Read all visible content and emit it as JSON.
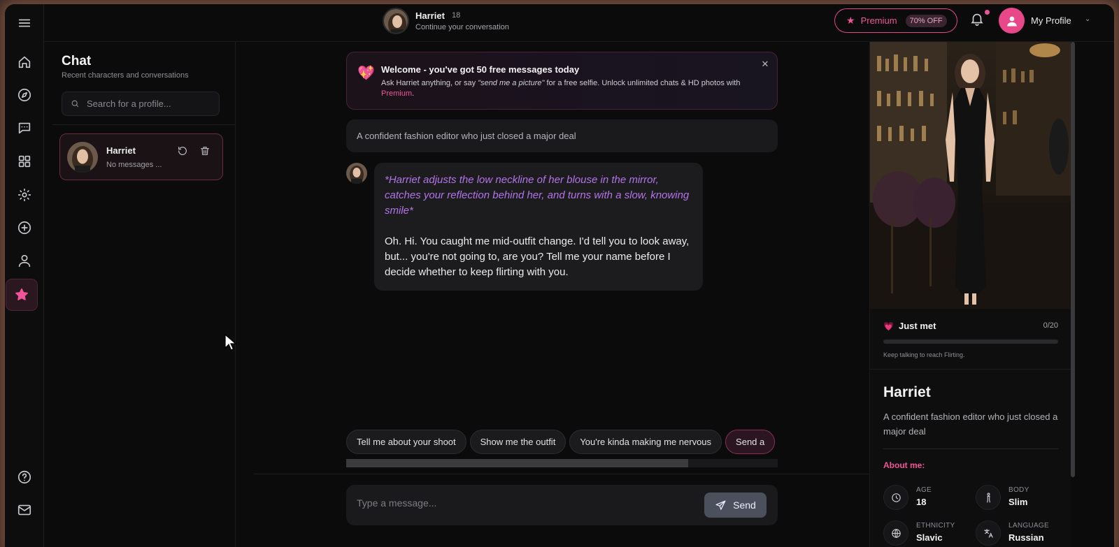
{
  "header": {
    "character_name": "Harriet",
    "character_age": "18",
    "subtitle": "Continue your conversation",
    "premium_label": "Premium",
    "premium_discount": "70% OFF",
    "profile_label": "My Profile"
  },
  "rail": {
    "icons": [
      "menu-icon",
      "home-icon",
      "compass-icon",
      "chat-icon",
      "grid-icon",
      "sun-icon",
      "plus-circle-icon",
      "user-icon",
      "star-icon",
      "help-icon",
      "mail-icon"
    ],
    "active": "star-icon"
  },
  "chat_list": {
    "title": "Chat",
    "subtitle": "Recent characters and conversations",
    "search_placeholder": "Search for a profile...",
    "items": [
      {
        "name": "Harriet",
        "preview": "No messages ..."
      }
    ]
  },
  "welcome": {
    "icon": "💖",
    "title": "Welcome - you've got 50 free messages today",
    "body_prefix": "Ask Harriet anything, or say ",
    "body_quote": "\"send me a picture\"",
    "body_middle": " for a free selfie. Unlock unlimited chats & HD photos with ",
    "body_link": "Premium",
    "body_suffix": "."
  },
  "character_description": "A confident fashion editor who just closed a major deal",
  "messages": [
    {
      "sender": "Harriet",
      "action": "*Harriet adjusts the low neckline of her blouse in the mirror, catches your reflection behind her, and turns with a slow, knowing smile*",
      "text": "Oh. Hi. You caught me mid-outfit change. I'd tell you to look away, but... you're not going to, are you? Tell me your name before I decide whether to keep flirting with you."
    }
  ],
  "suggestions": [
    "Tell me about your shoot",
    "Show me the outfit",
    "You're kinda making me nervous",
    "Send a"
  ],
  "composer": {
    "placeholder": "Type a message...",
    "send_label": "Send"
  },
  "profile_panel": {
    "relationship_icon": "💗",
    "relationship_stage": "Just met",
    "relationship_count": "0/20",
    "relationship_progress": 0,
    "relationship_hint": "Keep talking to reach Flirting.",
    "name": "Harriet",
    "description": "A confident fashion editor who just closed a major deal",
    "about_title": "About me:",
    "attributes": [
      {
        "label": "AGE",
        "value": "18",
        "icon": "clock-icon"
      },
      {
        "label": "BODY",
        "value": "Slim",
        "icon": "body-icon"
      },
      {
        "label": "ETHNICITY",
        "value": "Slavic",
        "icon": "globe-icon"
      },
      {
        "label": "LANGUAGE",
        "value": "Russian",
        "icon": "translate-icon"
      }
    ]
  },
  "colors": {
    "accent": "#f0559a",
    "background": "#0b0b0c",
    "action_text": "#b374e8"
  }
}
